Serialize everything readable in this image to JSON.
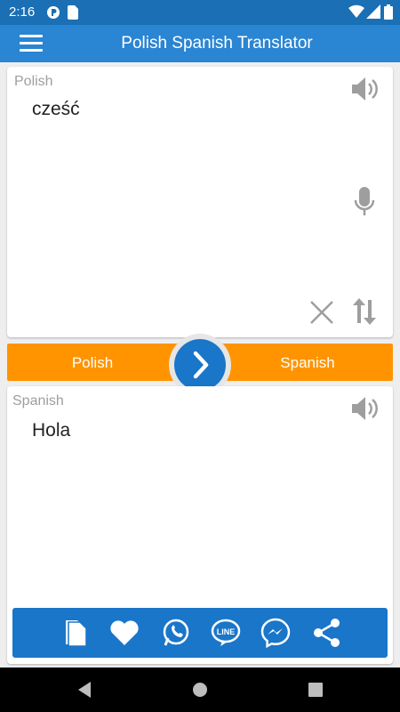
{
  "status_bar": {
    "time": "2:16",
    "icons": [
      "vpn-icon",
      "sim-icon",
      "wifi-icon",
      "signal-icon",
      "battery-icon"
    ]
  },
  "app_bar": {
    "title": "Polish Spanish Translator",
    "menu_icon": "hamburger-menu-icon"
  },
  "source_panel": {
    "language": "Polish",
    "text": "cześć",
    "icons": [
      "speaker-icon",
      "microphone-icon",
      "clear-icon",
      "swap-vertical-icon"
    ]
  },
  "language_bar": {
    "source": "Polish",
    "target": "Spanish",
    "translate_icon": "chevron-right-icon"
  },
  "target_panel": {
    "language": "Spanish",
    "text": "Hola",
    "icons": [
      "speaker-icon"
    ]
  },
  "action_bar": {
    "icons": [
      "copy-icon",
      "favorite-icon",
      "whatsapp-icon",
      "line-icon",
      "messenger-icon",
      "share-icon"
    ]
  },
  "colors": {
    "status_bar": "#1a6fb5",
    "app_bar": "#2a85d3",
    "language_bar": "#ff9400",
    "accent_blue": "#1a76c9",
    "label_gray": "#9e9e9e"
  }
}
